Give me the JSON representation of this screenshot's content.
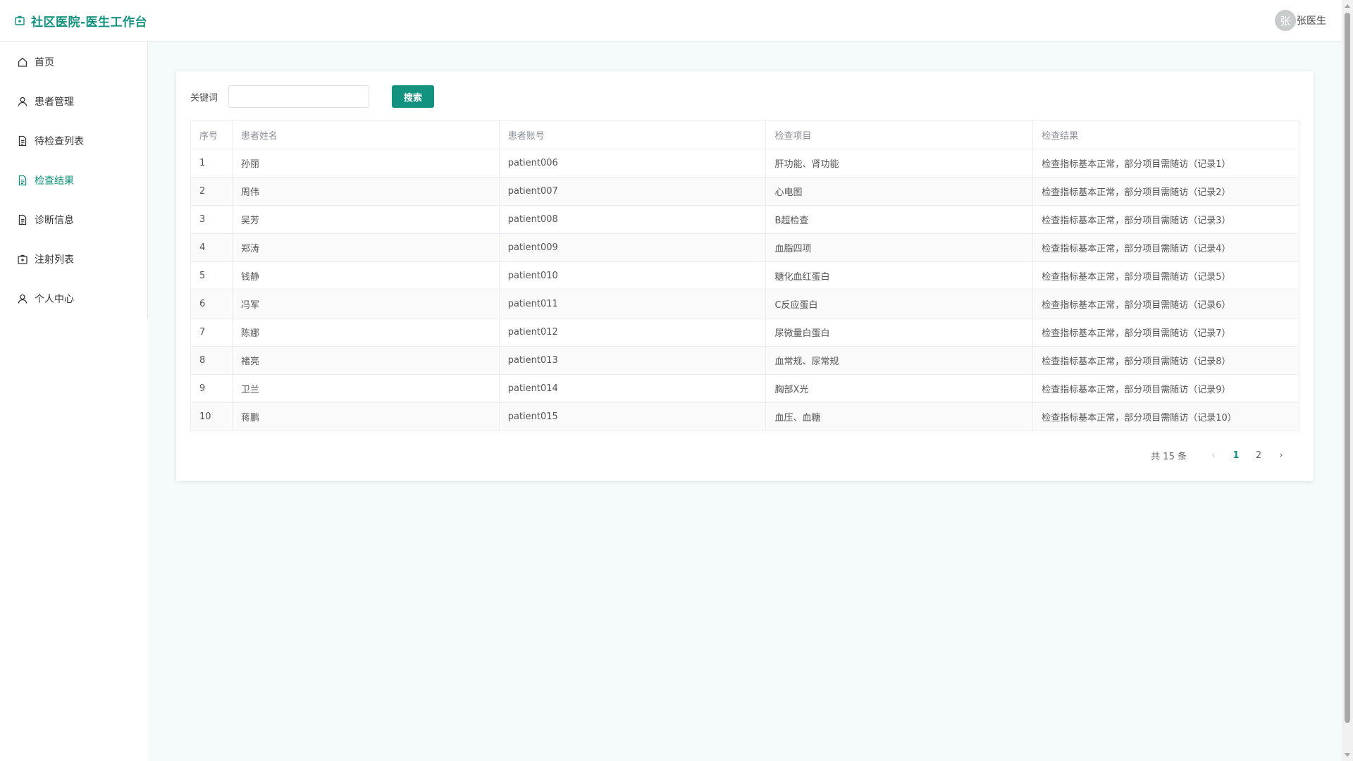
{
  "app": {
    "title": "社区医院-医生工作台",
    "avatar_char": "张",
    "username": "张医生",
    "accent_color": "#12927f"
  },
  "sidebar": {
    "items": [
      {
        "label": "首页",
        "icon": "home-icon"
      },
      {
        "label": "患者管理",
        "icon": "user-icon"
      },
      {
        "label": "待检查列表",
        "icon": "document-icon"
      },
      {
        "label": "检查结果",
        "icon": "document-icon",
        "active": true
      },
      {
        "label": "诊断信息",
        "icon": "document-icon"
      },
      {
        "label": "注射列表",
        "icon": "medical-kit-icon"
      },
      {
        "label": "个人中心",
        "icon": "user-icon"
      }
    ]
  },
  "search": {
    "label": "关键词",
    "value": "",
    "button_label": "搜索"
  },
  "table": {
    "headers": [
      "序号",
      "患者姓名",
      "患者账号",
      "检查项目",
      "检查结果"
    ],
    "rows": [
      [
        "1",
        "孙丽",
        "patient006",
        "肝功能、肾功能",
        "检查指标基本正常，部分项目需随访（记录1）"
      ],
      [
        "2",
        "周伟",
        "patient007",
        "心电图",
        "检查指标基本正常，部分项目需随访（记录2）"
      ],
      [
        "3",
        "吴芳",
        "patient008",
        "B超检查",
        "检查指标基本正常，部分项目需随访（记录3）"
      ],
      [
        "4",
        "郑涛",
        "patient009",
        "血脂四项",
        "检查指标基本正常，部分项目需随访（记录4）"
      ],
      [
        "5",
        "钱静",
        "patient010",
        "糖化血红蛋白",
        "检查指标基本正常，部分项目需随访（记录5）"
      ],
      [
        "6",
        "冯军",
        "patient011",
        "C反应蛋白",
        "检查指标基本正常，部分项目需随访（记录6）"
      ],
      [
        "7",
        "陈娜",
        "patient012",
        "尿微量白蛋白",
        "检查指标基本正常，部分项目需随访（记录7）"
      ],
      [
        "8",
        "褚亮",
        "patient013",
        "血常规、尿常规",
        "检查指标基本正常，部分项目需随访（记录8）"
      ],
      [
        "9",
        "卫兰",
        "patient014",
        "胸部X光",
        "检查指标基本正常，部分项目需随访（记录9）"
      ],
      [
        "10",
        "蒋鹏",
        "patient015",
        "血压、血糖",
        "检查指标基本正常，部分项目需随访（记录10）"
      ]
    ]
  },
  "pagination": {
    "total_text": "共 15 条",
    "prev": "‹",
    "next": "›",
    "pages": [
      "1",
      "2"
    ],
    "current": "1"
  }
}
